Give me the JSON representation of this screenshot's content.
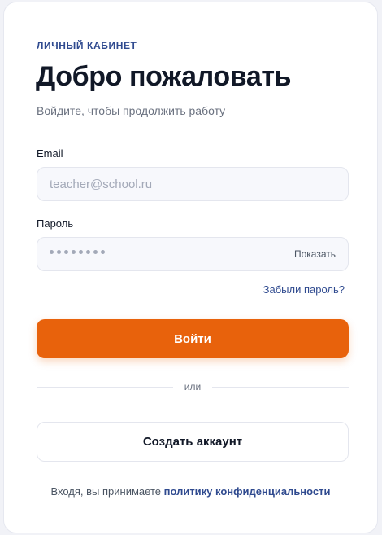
{
  "card": {
    "eyebrow": "ЛИЧНЫЙ КАБИНЕТ",
    "title": "Добро пожаловать",
    "subtitle": "Войдите, чтобы продолжить работу"
  },
  "form": {
    "email_label": "Email",
    "email_placeholder": "teacher@school.ru",
    "email_value": "",
    "password_label": "Пароль",
    "password_masked_length": 8,
    "show_password_label": "Показать",
    "forgot_link": "Забыли пароль?"
  },
  "actions": {
    "login_label": "Войти",
    "divider_text": "или",
    "create_account_label": "Создать аккаунт"
  },
  "footer": {
    "prefix": "Входя, вы принимаете",
    "policy_link": "политику конфиденциальности"
  },
  "colors": {
    "accent": "#e8620c",
    "link": "#2f4a8f"
  }
}
